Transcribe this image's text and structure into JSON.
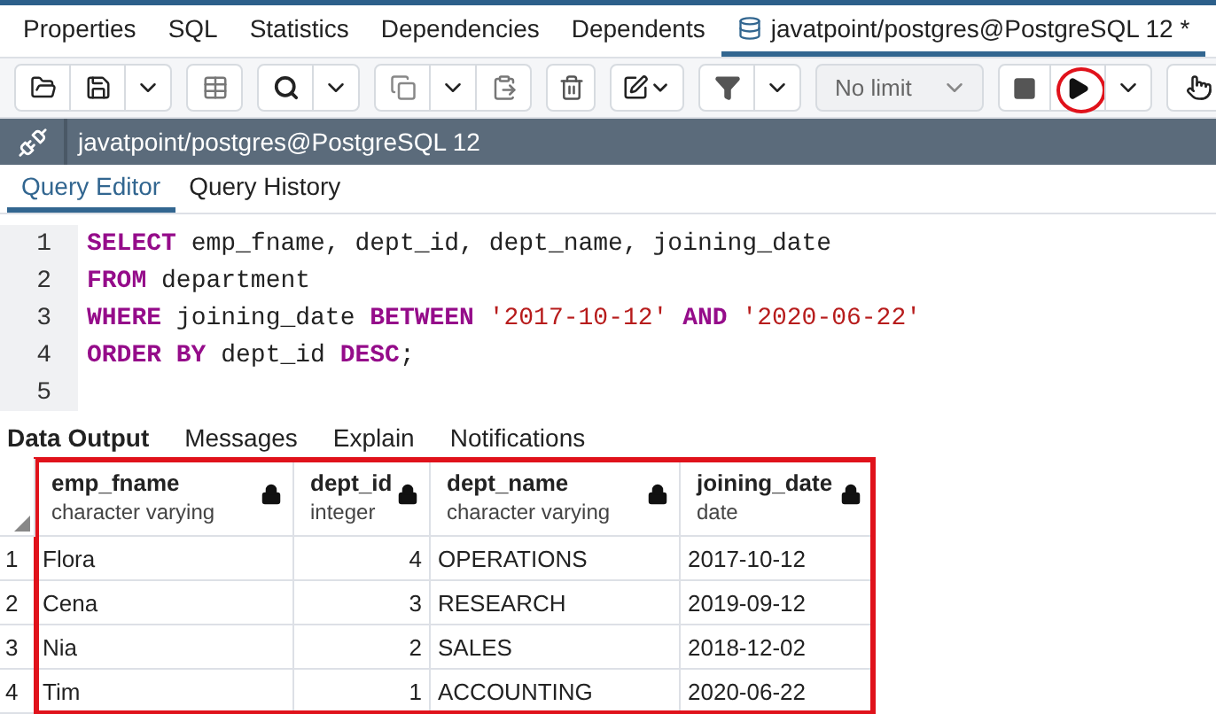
{
  "tabs": [
    {
      "label": "Properties",
      "selected": false
    },
    {
      "label": "SQL",
      "selected": false
    },
    {
      "label": "Statistics",
      "selected": false
    },
    {
      "label": "Dependencies",
      "selected": false
    },
    {
      "label": "Dependents",
      "selected": false
    },
    {
      "label": "javatpoint/postgres@PostgreSQL 12 *",
      "selected": true
    }
  ],
  "toolbar": {
    "limit": "No limit",
    "run_highlighted": true
  },
  "connection": {
    "title": "javatpoint/postgres@PostgreSQL 12"
  },
  "editor_tabs": [
    {
      "label": "Query Editor",
      "selected": true
    },
    {
      "label": "Query History",
      "selected": false
    }
  ],
  "editor": {
    "lines": [
      {
        "number": "1",
        "tokens": [
          {
            "kind": "keyword",
            "text": "SELECT"
          },
          {
            "kind": "plain",
            "text": " emp_fname, dept_id, dept_name, joining_date"
          }
        ]
      },
      {
        "number": "2",
        "tokens": [
          {
            "kind": "keyword",
            "text": "FROM"
          },
          {
            "kind": "plain",
            "text": " department"
          }
        ]
      },
      {
        "number": "3",
        "tokens": [
          {
            "kind": "keyword",
            "text": "WHERE"
          },
          {
            "kind": "plain",
            "text": " joining_date "
          },
          {
            "kind": "keyword",
            "text": "BETWEEN"
          },
          {
            "kind": "string",
            "text": " '2017-10-12'"
          },
          {
            "kind": "keyword",
            "text": " AND"
          },
          {
            "kind": "string",
            "text": " '2020-06-22'"
          }
        ]
      },
      {
        "number": "4",
        "tokens": [
          {
            "kind": "keyword",
            "text": "ORDER BY"
          },
          {
            "kind": "plain",
            "text": " dept_id "
          },
          {
            "kind": "keyword",
            "text": "DESC"
          },
          {
            "kind": "plain",
            "text": ";"
          }
        ]
      },
      {
        "number": "5"
      }
    ]
  },
  "output_tabs": [
    {
      "label": "Data Output",
      "selected": true
    },
    {
      "label": "Messages",
      "selected": false
    },
    {
      "label": "Explain",
      "selected": false
    },
    {
      "label": "Notifications",
      "selected": false
    }
  ],
  "table": {
    "highlighted": true,
    "columns": [
      {
        "name": "emp_fname",
        "type": "character varying"
      },
      {
        "name": "dept_id",
        "type": "integer"
      },
      {
        "name": "dept_name",
        "type": "character varying"
      },
      {
        "name": "joining_date",
        "type": "date"
      }
    ],
    "rows": [
      {
        "number": "1",
        "cells": [
          "Flora",
          "4",
          "OPERATIONS",
          "2017-10-12"
        ]
      },
      {
        "number": "2",
        "cells": [
          "Cena",
          "3",
          "RESEARCH",
          "2019-09-12"
        ]
      },
      {
        "number": "3",
        "cells": [
          "Nia",
          "2",
          "SALES",
          "2018-12-02"
        ]
      },
      {
        "number": "4",
        "cells": [
          "Tim",
          "1",
          "ACCOUNTING",
          "2020-06-22"
        ]
      }
    ]
  }
}
